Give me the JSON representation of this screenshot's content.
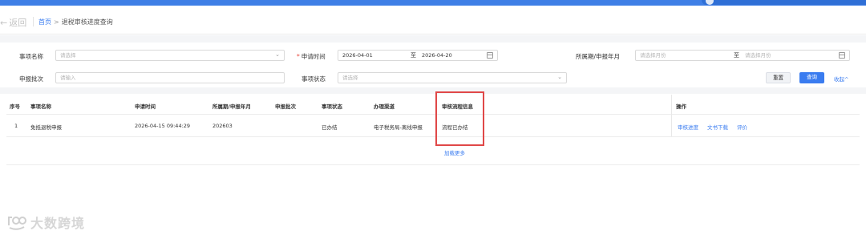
{
  "nav": {
    "back_label": "返回",
    "breadcrumb_home": "首页",
    "breadcrumb_sep": ">",
    "breadcrumb_current": "退税审核进度查询"
  },
  "form": {
    "item_name_label": "事项名称",
    "item_name_placeholder": "请选择",
    "apply_time_required": "*",
    "apply_time_label": "申请时间",
    "apply_time_start": "2026-04-01",
    "apply_time_to": "至",
    "apply_time_end": "2026-04-20",
    "period_label": "所属期/申报年月",
    "period_start_placeholder": "请选择月份",
    "period_to": "至",
    "period_end_placeholder": "请选择月份",
    "batch_label": "申报批次",
    "batch_placeholder": "请输入",
    "status_label": "事项状态",
    "status_placeholder": "请选择",
    "reset_label": "重置",
    "query_label": "查询",
    "collapse_label": "收起^"
  },
  "table": {
    "headers": [
      "序号",
      "事项名称",
      "申请时间",
      "所属期/申报年月",
      "申报批次",
      "事项状态",
      "办理渠道",
      "审核流程信息",
      "操作"
    ],
    "rows": [
      {
        "index": "1",
        "item_name": "免抵退税申报",
        "apply_time": "2026-04-15 09:44:29",
        "period": "202603",
        "batch": "",
        "status": "已办结",
        "channel": "电子税务局-离线申报",
        "review_info": "流程已办结",
        "actions": [
          "审核进度",
          "文书下载",
          "评价"
        ]
      }
    ],
    "load_more": "加载更多"
  },
  "watermark": {
    "text": "大数跨境"
  },
  "colors": {
    "accent": "#3a7cf0",
    "highlight_box": "#e04848",
    "required": "#e8483c"
  }
}
